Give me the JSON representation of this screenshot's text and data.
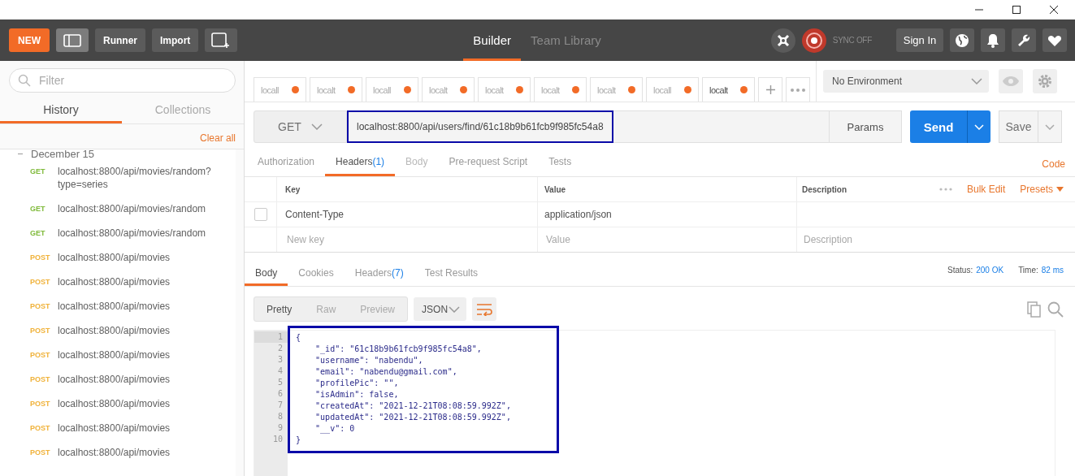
{
  "header": {
    "new_button": "NEW",
    "runner_button": "Runner",
    "import_button": "Import",
    "nav": [
      {
        "label": "Builder",
        "selected": true
      },
      {
        "label": "Team Library",
        "selected": false
      }
    ],
    "sync_label": "SYNC OFF",
    "sign_in": "Sign In"
  },
  "sidebar": {
    "filter_placeholder": "Filter",
    "tabs": [
      {
        "label": "History",
        "selected": true
      },
      {
        "label": "Collections",
        "selected": false
      }
    ],
    "clear_all": "Clear all",
    "group": "December 15",
    "items": [
      {
        "method": "GET",
        "url": "localhost:8800/api/movies/random?type=series"
      },
      {
        "method": "GET",
        "url": "localhost:8800/api/movies/random"
      },
      {
        "method": "GET",
        "url": "localhost:8800/api/movies/random"
      },
      {
        "method": "POST",
        "url": "localhost:8800/api/movies"
      },
      {
        "method": "POST",
        "url": "localhost:8800/api/movies"
      },
      {
        "method": "POST",
        "url": "localhost:8800/api/movies"
      },
      {
        "method": "POST",
        "url": "localhost:8800/api/movies"
      },
      {
        "method": "POST",
        "url": "localhost:8800/api/movies"
      },
      {
        "method": "POST",
        "url": "localhost:8800/api/movies"
      },
      {
        "method": "POST",
        "url": "localhost:8800/api/movies"
      },
      {
        "method": "POST",
        "url": "localhost:8800/api/movies"
      },
      {
        "method": "POST",
        "url": "localhost:8800/api/movies"
      }
    ]
  },
  "request_tabs": [
    {
      "label": "locall",
      "selected": false
    },
    {
      "label": "localt",
      "selected": false
    },
    {
      "label": "locall",
      "selected": false
    },
    {
      "label": "localt",
      "selected": false
    },
    {
      "label": "localt",
      "selected": false
    },
    {
      "label": "localt",
      "selected": false
    },
    {
      "label": "localt",
      "selected": false
    },
    {
      "label": "locall",
      "selected": false
    },
    {
      "label": "localt",
      "selected": true
    }
  ],
  "environment": "No Environment",
  "request": {
    "method": "GET",
    "url": "localhost:8800/api/users/find/61c18b9b61fcb9f985fc54a8",
    "highlighted": true,
    "params": "Params",
    "send": "Send",
    "save": "Save"
  },
  "request_subtabs": [
    {
      "label": "Authorization",
      "selected": false,
      "disabled": false
    },
    {
      "label": "Headers",
      "count": "(1)",
      "selected": true,
      "disabled": false
    },
    {
      "label": "Body",
      "selected": false,
      "disabled": true
    },
    {
      "label": "Pre-request Script",
      "selected": false,
      "disabled": false
    },
    {
      "label": "Tests",
      "selected": false,
      "disabled": false
    }
  ],
  "code_link": "Code",
  "headers_table": {
    "columns": [
      "Key",
      "Value",
      "Description"
    ],
    "bulk_edit": "Bulk Edit",
    "presets": "Presets",
    "rows": [
      {
        "key": "Content-Type",
        "value": "application/json",
        "checked": false
      }
    ],
    "new_row": {
      "key": {
        "placeholder": "New key"
      },
      "value": {
        "placeholder": "Value"
      },
      "description": {
        "placeholder": "Description"
      }
    }
  },
  "response": {
    "tabs": [
      {
        "label": "Body",
        "selected": true
      },
      {
        "label": "Cookies",
        "selected": false
      },
      {
        "label": "Headers",
        "count": "(7)",
        "selected": false
      },
      {
        "label": "Test Results",
        "selected": false
      }
    ],
    "status_label": "Status:",
    "status": "200 OK",
    "time_label": "Time:",
    "time": "82 ms",
    "views": [
      {
        "label": "Pretty",
        "selected": true
      },
      {
        "label": "Raw",
        "selected": false
      },
      {
        "label": "Preview",
        "selected": false
      }
    ],
    "format": "JSON",
    "highlighted": true,
    "lines": [
      {
        "n": "1",
        "text": "{"
      },
      {
        "n": "2",
        "text": "    \"_id\": \"61c18b9b61fcb9f985fc54a8\","
      },
      {
        "n": "3",
        "text": "    \"username\": \"nabendu\","
      },
      {
        "n": "4",
        "text": "    \"email\": \"nabendu@gmail.com\","
      },
      {
        "n": "5",
        "text": "    \"profilePic\": \"\","
      },
      {
        "n": "6",
        "text": "    \"isAdmin\": false,"
      },
      {
        "n": "7",
        "text": "    \"createdAt\": \"2021-12-21T08:08:59.992Z\","
      },
      {
        "n": "8",
        "text": "    \"updatedAt\": \"2021-12-21T08:08:59.992Z\","
      },
      {
        "n": "9",
        "text": "    \"__v\": 0"
      },
      {
        "n": "10",
        "text": "}"
      }
    ]
  }
}
